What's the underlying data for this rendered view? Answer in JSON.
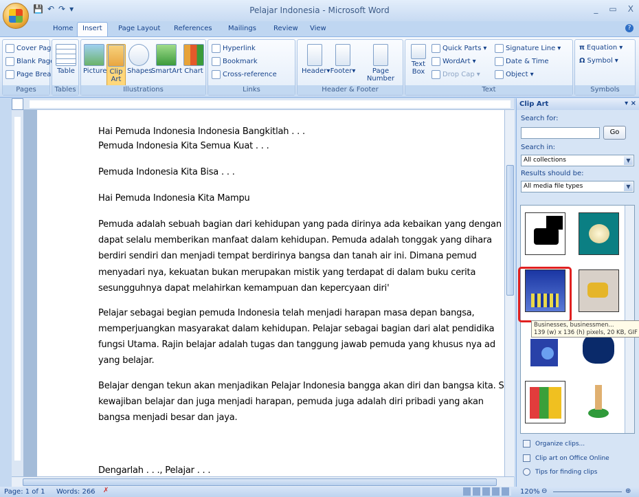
{
  "window": {
    "title": "Pelajar Indonesia - Microsoft Word",
    "controls": [
      "_",
      "▭",
      "X"
    ]
  },
  "tabs": [
    "Home",
    "Insert",
    "Page Layout",
    "References",
    "Mailings",
    "Review",
    "View"
  ],
  "ribbon": {
    "pages": {
      "label": "Pages",
      "items": [
        "Cover Page",
        "Blank Page",
        "Page Break"
      ]
    },
    "tables": {
      "label": "Tables",
      "item": "Table"
    },
    "illustrations": {
      "label": "Illustrations",
      "items": [
        "Picture",
        "Clip\nArt",
        "Shapes",
        "SmartArt",
        "Chart"
      ]
    },
    "links": {
      "label": "Links",
      "items": [
        "Hyperlink",
        "Bookmark",
        "Cross-reference"
      ]
    },
    "header_footer": {
      "label": "Header & Footer",
      "items": [
        "Header",
        "Footer",
        "Page\nNumber"
      ]
    },
    "text": {
      "label": "Text",
      "items": [
        "Text\nBox",
        "Quick Parts",
        "WordArt",
        "Drop Cap",
        "Signature Line",
        "Date & Time",
        "Object"
      ]
    },
    "symbols": {
      "label": "Symbols",
      "items": [
        "Equation",
        "Symbol"
      ]
    }
  },
  "document": {
    "lines": [
      "Hai Pemuda Indonesia Indonesia Bangkitlah . . .",
      "Pemuda Indonesia Kita Semua Kuat . . .",
      "Pemuda Indonesia Kita Bisa . . .",
      "Hai Pemuda Indonesia Kita Mampu",
      "Pemuda adalah sebuah bagian dari kehidupan yang pada dirinya ada kebaikan yang dengan k",
      "dapat selalu memberikan manfaat dalam kehidupan. Pemuda adalah tonggak yang dihara",
      "berdiri sendiri dan menjadi tempat berdirinya bangsa dan tanah air ini. Dimana pemud",
      "menyadari nya, kekuatan bukan merupakan mistik yang terdapat di dalam buku cerita",
      "sesungguhnya dapat melahirkan kemampuan dan kepercyaan diri'",
      "Pelajar sebagai begian pemuda Indonesia telah menjadi harapan masa depan bangsa,",
      "memperjuangkan masyarakat dalam kehidupan. Pelajar sebagai bagian dari alat pendidika",
      "fungsi Utama. Rajin belajar adalah tugas dan tanggung jawab pemuda yang khusus nya ad",
      "yang belajar.",
      "Belajar dengan tekun akan menjadikan Pelajar Indonesia bangga akan diri dan bangsa kita. Se",
      "kewajiban belajar dan juga menjadi harapan, pemuda juga adalah diri pribadi yang akan",
      "bangsa menjadi besar dan jaya.",
      "Dengarlah . . ., Pelajar . . ."
    ]
  },
  "clipart_pane": {
    "title": "Clip Art",
    "search_label": "Search for:",
    "search_value": "",
    "go_label": "Go",
    "search_in_label": "Search in:",
    "search_in_value": "All collections",
    "results_label": "Results should be:",
    "results_value": "All media file types",
    "tooltip_line1": "Businesses, businessmen...",
    "tooltip_line2": "139 (w) x 136 (h) pixels, 20 KB, GIF",
    "links": [
      "Organize clips...",
      "Clip art on Office Online",
      "Tips for finding clips"
    ]
  },
  "status": {
    "page": "Page: 1 of 1",
    "words": "Words: 266",
    "zoom": "120%"
  }
}
